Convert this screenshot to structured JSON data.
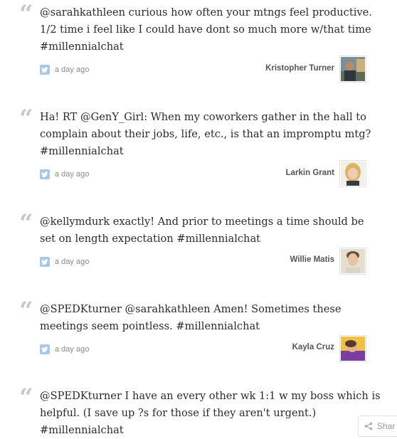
{
  "tweets": [
    {
      "lines": [
        "@sarahkathleen curious how often your mtngs feel productive.",
        "1/2 time i feel like I could have dont so much more w/that time",
        "#millennialchat"
      ],
      "time": "a day ago",
      "author": "Kristopher Turner",
      "avatar_icon": "avatar-man-outdoor"
    },
    {
      "lines": [
        "Ha! RT @GenY_Girl: When my coworkers gather in the hall to",
        "complain about their jobs, life, etc., is that an impromptu mtg?",
        "#millennialchat"
      ],
      "time": "a day ago",
      "author": "Larkin Grant",
      "avatar_icon": "avatar-woman-blonde"
    },
    {
      "lines": [
        "@kellymdurk exactly! And prior to meetings a time should be",
        "set on length expectation #millennialchat"
      ],
      "time": "a day ago",
      "author": "Willie Matis",
      "avatar_icon": "avatar-man-portrait"
    },
    {
      "lines": [
        "@SPEDKturner @sarahkathleen Amen! Sometimes these",
        "meetings seem pointless. #millennialchat"
      ],
      "time": "a day ago",
      "author": "Kayla Cruz",
      "avatar_icon": "avatar-woman-purple"
    },
    {
      "lines": [
        "@SPEDKturner I have an every other wk 1:1 w my boss which is",
        "helpful. (I save up ?s for those if they aren't urgent.)",
        "#millennialchat"
      ]
    }
  ],
  "quote_glyph": "“",
  "share": {
    "label": "Shar",
    "icon": "share-icon"
  },
  "colors": {
    "twitter_icon": "#a8c8e6",
    "quote": "#c8c8c8",
    "text": "#2b2b2b"
  }
}
